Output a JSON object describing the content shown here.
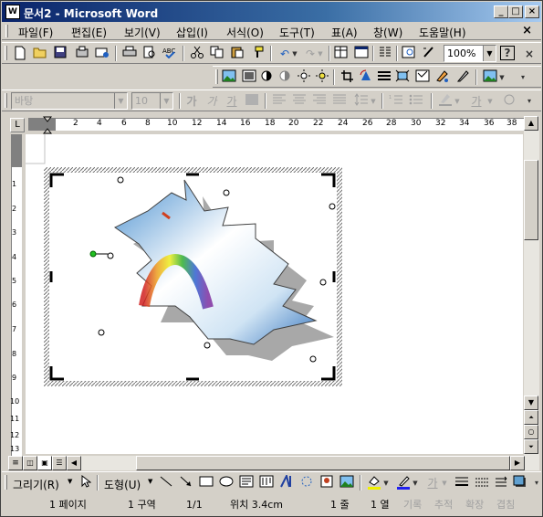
{
  "window": {
    "title": "문서2 - Microsoft Word",
    "app_icon": "W",
    "controls": {
      "minimize": "_",
      "maximize": "□",
      "close": "×"
    }
  },
  "menubar": {
    "items": [
      "파일(F)",
      "편집(E)",
      "보기(V)",
      "삽입(I)",
      "서식(O)",
      "도구(T)",
      "표(A)",
      "창(W)",
      "도움말(H)"
    ],
    "close": "×"
  },
  "standard_toolbar": {
    "zoom": "100%",
    "help": "?"
  },
  "format_toolbar": {
    "font": "바탕",
    "size": "10",
    "bold": "가",
    "italic": "가",
    "underline": "가",
    "color_letter": "가"
  },
  "ruler": {
    "tab_selector": "L",
    "h_ticks": [
      "2",
      "4",
      "6",
      "8",
      "10",
      "12",
      "14",
      "16",
      "18",
      "20",
      "22",
      "24",
      "26",
      "28",
      "30",
      "32",
      "34",
      "36",
      "38"
    ],
    "v_ticks": [
      "1",
      "2",
      "3",
      "4",
      "5",
      "6",
      "7",
      "8",
      "9",
      "10",
      "11",
      "12",
      "13"
    ]
  },
  "drawing_toolbar": {
    "draw": "그리기(R)",
    "autoshapes": "도형(U)",
    "text_color": "가"
  },
  "statusbar": {
    "page": "1 페이지",
    "section": "1 구역",
    "pages": "1/1",
    "position": "위치 3.4cm",
    "line": "1 줄",
    "column": "1 열",
    "rec": "기록",
    "trk": "추적",
    "ext": "확장",
    "ovr": "겹침"
  }
}
